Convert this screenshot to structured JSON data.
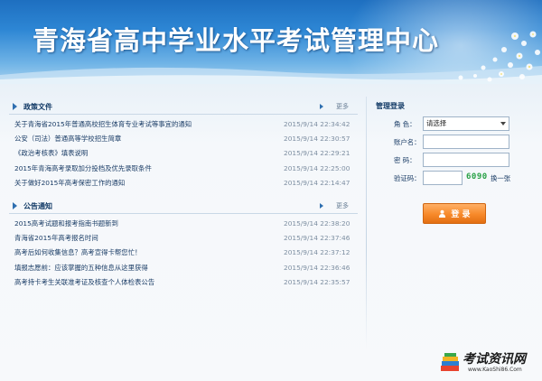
{
  "banner": {
    "title": "青海省高中学业水平考试管理中心"
  },
  "policy": {
    "title": "政策文件",
    "more": "更多",
    "items": [
      {
        "title": "关于青海省2015年普通高校招生体育专业考试等事宜的通知",
        "date": "2015/9/14 22:34:42"
      },
      {
        "title": "公安（司法）普通高等学校招生简章",
        "date": "2015/9/14 22:30:57"
      },
      {
        "title": "《政治考核表》填表说明",
        "date": "2015/9/14 22:29:21"
      },
      {
        "title": "2015年青海高考录取加分投档及优先录取条件",
        "date": "2015/9/14 22:25:00"
      },
      {
        "title": "关于做好2015年高考保密工作的通知",
        "date": "2015/9/14 22:14:47"
      }
    ]
  },
  "notice": {
    "title": "公告通知",
    "more": "更多",
    "items": [
      {
        "title": "2015高考试题和报考指南书题新到",
        "date": "2015/9/14 22:38:20"
      },
      {
        "title": "青海省2015年高考报名时间",
        "date": "2015/9/14 22:37:46"
      },
      {
        "title": "高考后如何收集信息？高考宣得卡帮您忙！",
        "date": "2015/9/14 22:37:12"
      },
      {
        "title": "填报志愿前：应该掌握的五种信息从这里获得",
        "date": "2015/9/14 22:36:46"
      },
      {
        "title": "高考持卡考生关联准考证及核查个人体检表公告",
        "date": "2015/9/14 22:35:57"
      }
    ]
  },
  "login": {
    "title": "管理登录",
    "role_label": "角  色：",
    "role_value": "请选择",
    "account_label": "账户名：",
    "password_label": "密  码：",
    "captcha_label": "验证码：",
    "captcha_code": "6090",
    "refresh_label": "换一张",
    "submit_label": "登 录"
  },
  "logo": {
    "name": "考试资讯网",
    "url": "www.KaoShi86.Com"
  },
  "colors": {
    "accent": "#f7892a",
    "captcha": "#27a045",
    "link": "#1a3c66"
  }
}
